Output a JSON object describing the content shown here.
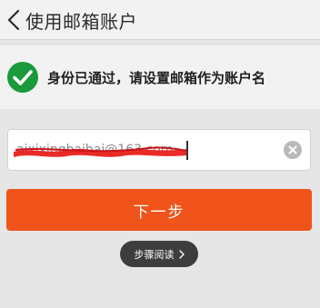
{
  "header": {
    "title": "使用邮箱账户",
    "back_icon": "chevron-left-icon"
  },
  "notice": {
    "icon": "check-circle-icon",
    "icon_color": "#1a9a3a",
    "text": "身份已通过，请设置邮箱作为账户名"
  },
  "email_field": {
    "value": "aixixingbaibai@163.com",
    "redaction_color": "#e8201e",
    "clear_icon": "clear-circle-icon"
  },
  "primary_button": {
    "label": "下一步",
    "color": "#f0541a"
  },
  "steps_pill": {
    "label": "步骤阅读",
    "icon": "chevron-right-icon"
  }
}
